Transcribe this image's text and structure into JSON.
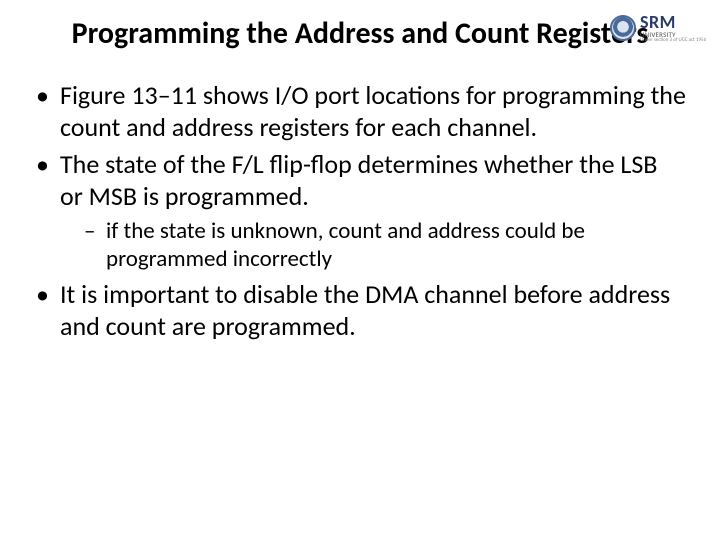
{
  "title": "Programming the Address and Count Registers",
  "logo": {
    "main": "SRM",
    "sub": "UNIVERSITY",
    "tag": "Under section 3 of UGC act 1956"
  },
  "bullets": {
    "b1": "Figure 13–11 shows I/O port locations for programming the count and address registers for each channel.",
    "b2": "The state of the F/L flip-flop determines whether the LSB or MSB is programmed.",
    "b2_sub1": "if the state is unknown, count and address could be programmed incorrectly",
    "b3": "It is important to disable the DMA channel before address and count are programmed."
  }
}
